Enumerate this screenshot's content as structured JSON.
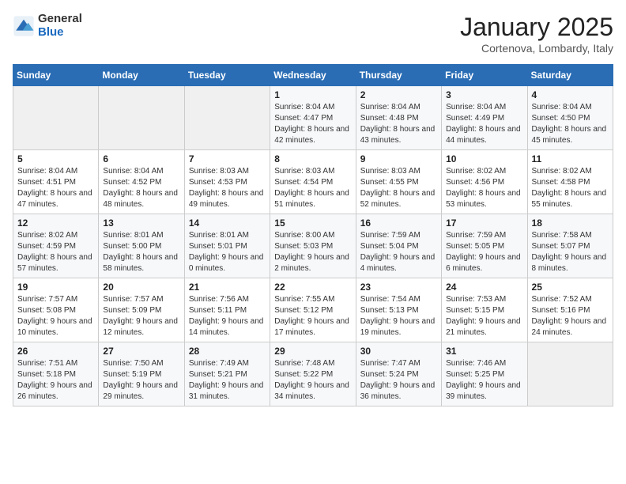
{
  "header": {
    "logo_general": "General",
    "logo_blue": "Blue",
    "month": "January 2025",
    "location": "Cortenova, Lombardy, Italy"
  },
  "weekdays": [
    "Sunday",
    "Monday",
    "Tuesday",
    "Wednesday",
    "Thursday",
    "Friday",
    "Saturday"
  ],
  "weeks": [
    [
      {
        "day": "",
        "info": ""
      },
      {
        "day": "",
        "info": ""
      },
      {
        "day": "",
        "info": ""
      },
      {
        "day": "1",
        "info": "Sunrise: 8:04 AM\nSunset: 4:47 PM\nDaylight: 8 hours and 42 minutes."
      },
      {
        "day": "2",
        "info": "Sunrise: 8:04 AM\nSunset: 4:48 PM\nDaylight: 8 hours and 43 minutes."
      },
      {
        "day": "3",
        "info": "Sunrise: 8:04 AM\nSunset: 4:49 PM\nDaylight: 8 hours and 44 minutes."
      },
      {
        "day": "4",
        "info": "Sunrise: 8:04 AM\nSunset: 4:50 PM\nDaylight: 8 hours and 45 minutes."
      }
    ],
    [
      {
        "day": "5",
        "info": "Sunrise: 8:04 AM\nSunset: 4:51 PM\nDaylight: 8 hours and 47 minutes."
      },
      {
        "day": "6",
        "info": "Sunrise: 8:04 AM\nSunset: 4:52 PM\nDaylight: 8 hours and 48 minutes."
      },
      {
        "day": "7",
        "info": "Sunrise: 8:03 AM\nSunset: 4:53 PM\nDaylight: 8 hours and 49 minutes."
      },
      {
        "day": "8",
        "info": "Sunrise: 8:03 AM\nSunset: 4:54 PM\nDaylight: 8 hours and 51 minutes."
      },
      {
        "day": "9",
        "info": "Sunrise: 8:03 AM\nSunset: 4:55 PM\nDaylight: 8 hours and 52 minutes."
      },
      {
        "day": "10",
        "info": "Sunrise: 8:02 AM\nSunset: 4:56 PM\nDaylight: 8 hours and 53 minutes."
      },
      {
        "day": "11",
        "info": "Sunrise: 8:02 AM\nSunset: 4:58 PM\nDaylight: 8 hours and 55 minutes."
      }
    ],
    [
      {
        "day": "12",
        "info": "Sunrise: 8:02 AM\nSunset: 4:59 PM\nDaylight: 8 hours and 57 minutes."
      },
      {
        "day": "13",
        "info": "Sunrise: 8:01 AM\nSunset: 5:00 PM\nDaylight: 8 hours and 58 minutes."
      },
      {
        "day": "14",
        "info": "Sunrise: 8:01 AM\nSunset: 5:01 PM\nDaylight: 9 hours and 0 minutes."
      },
      {
        "day": "15",
        "info": "Sunrise: 8:00 AM\nSunset: 5:03 PM\nDaylight: 9 hours and 2 minutes."
      },
      {
        "day": "16",
        "info": "Sunrise: 7:59 AM\nSunset: 5:04 PM\nDaylight: 9 hours and 4 minutes."
      },
      {
        "day": "17",
        "info": "Sunrise: 7:59 AM\nSunset: 5:05 PM\nDaylight: 9 hours and 6 minutes."
      },
      {
        "day": "18",
        "info": "Sunrise: 7:58 AM\nSunset: 5:07 PM\nDaylight: 9 hours and 8 minutes."
      }
    ],
    [
      {
        "day": "19",
        "info": "Sunrise: 7:57 AM\nSunset: 5:08 PM\nDaylight: 9 hours and 10 minutes."
      },
      {
        "day": "20",
        "info": "Sunrise: 7:57 AM\nSunset: 5:09 PM\nDaylight: 9 hours and 12 minutes."
      },
      {
        "day": "21",
        "info": "Sunrise: 7:56 AM\nSunset: 5:11 PM\nDaylight: 9 hours and 14 minutes."
      },
      {
        "day": "22",
        "info": "Sunrise: 7:55 AM\nSunset: 5:12 PM\nDaylight: 9 hours and 17 minutes."
      },
      {
        "day": "23",
        "info": "Sunrise: 7:54 AM\nSunset: 5:13 PM\nDaylight: 9 hours and 19 minutes."
      },
      {
        "day": "24",
        "info": "Sunrise: 7:53 AM\nSunset: 5:15 PM\nDaylight: 9 hours and 21 minutes."
      },
      {
        "day": "25",
        "info": "Sunrise: 7:52 AM\nSunset: 5:16 PM\nDaylight: 9 hours and 24 minutes."
      }
    ],
    [
      {
        "day": "26",
        "info": "Sunrise: 7:51 AM\nSunset: 5:18 PM\nDaylight: 9 hours and 26 minutes."
      },
      {
        "day": "27",
        "info": "Sunrise: 7:50 AM\nSunset: 5:19 PM\nDaylight: 9 hours and 29 minutes."
      },
      {
        "day": "28",
        "info": "Sunrise: 7:49 AM\nSunset: 5:21 PM\nDaylight: 9 hours and 31 minutes."
      },
      {
        "day": "29",
        "info": "Sunrise: 7:48 AM\nSunset: 5:22 PM\nDaylight: 9 hours and 34 minutes."
      },
      {
        "day": "30",
        "info": "Sunrise: 7:47 AM\nSunset: 5:24 PM\nDaylight: 9 hours and 36 minutes."
      },
      {
        "day": "31",
        "info": "Sunrise: 7:46 AM\nSunset: 5:25 PM\nDaylight: 9 hours and 39 minutes."
      },
      {
        "day": "",
        "info": ""
      }
    ]
  ]
}
